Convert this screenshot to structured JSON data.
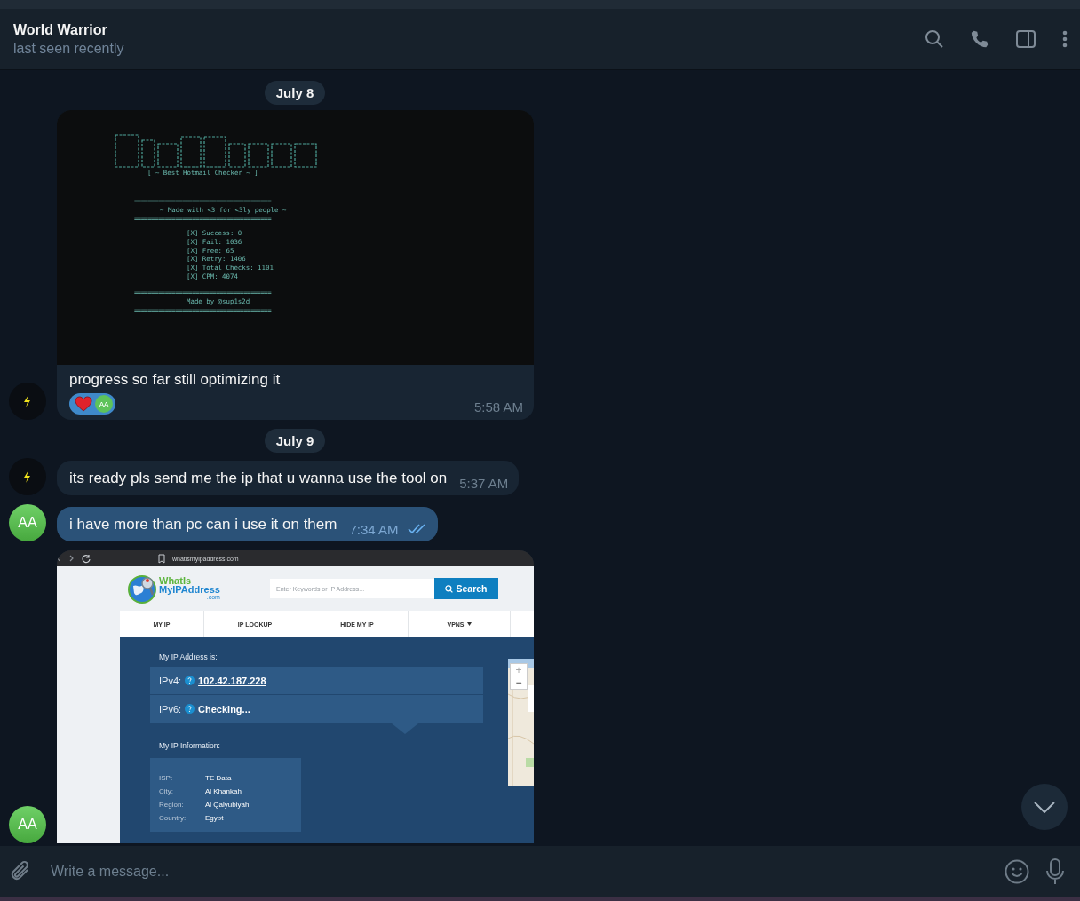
{
  "header": {
    "title": "World Warrior",
    "status": "last seen recently"
  },
  "messages": [
    {
      "kind": "date",
      "text": "July 8"
    },
    {
      "kind": "terminal",
      "outgoing": false,
      "terminal": {
        "tagline": "[ ~ Best Hotmail Checker ~ ]",
        "rule": "========================================",
        "credit_line": "~ Made with <3 for <3ly people ~",
        "stats": [
          "[X] Success: 0",
          "[X] Fail: 1036",
          "[X] Free: 65",
          "[X] Retry: 1406",
          "[X] Total Checks: 1101",
          "[X] CPM: 4074"
        ],
        "footer": "Made by @sup1s2d"
      },
      "text": "progress so far still optimizing it",
      "reaction": {
        "initials": "AA"
      },
      "time": "5:58 AM"
    },
    {
      "kind": "date",
      "text": "July 9"
    },
    {
      "kind": "text",
      "outgoing": false,
      "text": "its ready pls send me the ip that u wanna use the tool on",
      "time": "5:37 AM"
    },
    {
      "kind": "text",
      "outgoing": true,
      "avatar": "AA",
      "text": "i have more than pc can i use it on them",
      "time": "7:34 AM",
      "read": true
    },
    {
      "kind": "browser",
      "outgoing": true,
      "avatar": "AA",
      "browser": {
        "url": "whatismyipaddress.com",
        "logo_top": "WhatIs",
        "logo_bottom": "MyIPAddress",
        "logo_suffix": ".com",
        "search_placeholder": "Enter Keywords or IP Address...",
        "search_button": "Search",
        "nav": [
          "MY IP",
          "IP LOOKUP",
          "HIDE MY IP",
          "VPNS"
        ],
        "address_heading": "My IP Address is:",
        "ipv4_label": "IPv4:",
        "ipv4": "102.42.187.228",
        "ipv6_label": "IPv6:",
        "ipv6": "Checking...",
        "info_heading": "My IP Information:",
        "info": [
          {
            "label": "ISP:",
            "value": "TE Data"
          },
          {
            "label": "City:",
            "value": "Al Khankah"
          },
          {
            "label": "Region:",
            "value": "Al Qalyubiyah"
          },
          {
            "label": "Country:",
            "value": "Egypt"
          }
        ],
        "zoom_in": "+",
        "zoom_out": "−"
      }
    }
  ],
  "composer": {
    "placeholder": "Write a message..."
  }
}
